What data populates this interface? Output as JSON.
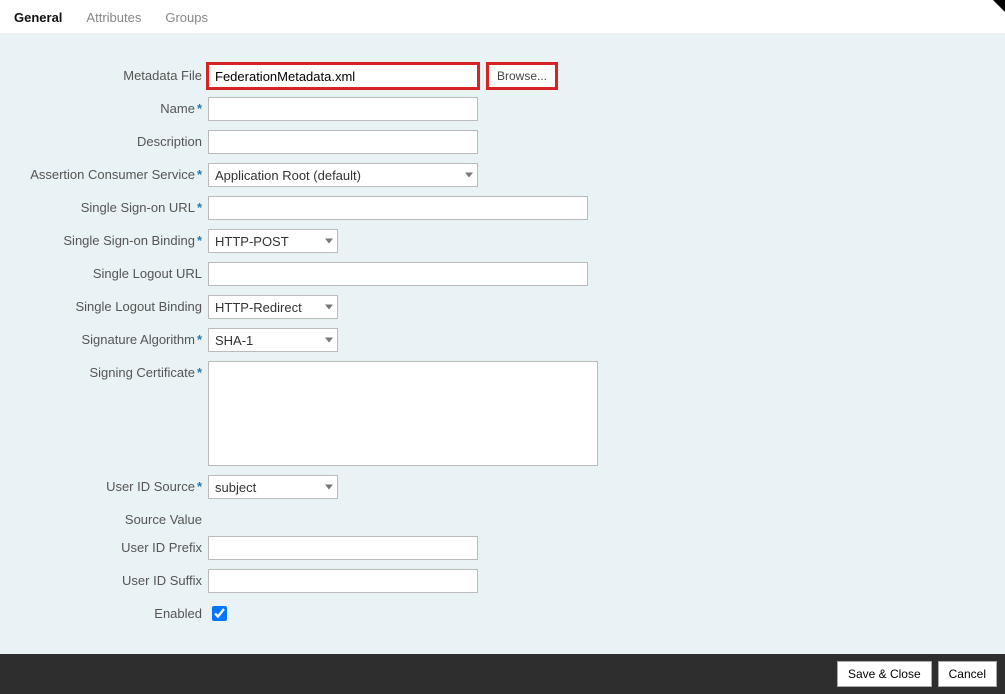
{
  "tabs": {
    "general": "General",
    "attributes": "Attributes",
    "groups": "Groups"
  },
  "labels": {
    "metadata_file": "Metadata File",
    "name": "Name",
    "description": "Description",
    "acs": "Assertion Consumer Service",
    "sso_url": "Single Sign-on URL",
    "sso_binding": "Single Sign-on Binding",
    "slo_url": "Single Logout URL",
    "slo_binding": "Single Logout Binding",
    "sig_alg": "Signature Algorithm",
    "signing_cert": "Signing Certificate",
    "uid_source": "User ID Source",
    "source_value": "Source Value",
    "uid_prefix": "User ID Prefix",
    "uid_suffix": "User ID Suffix",
    "enabled": "Enabled"
  },
  "values": {
    "metadata_file": "FederationMetadata.xml",
    "name": "",
    "description": "",
    "acs": "Application Root (default)",
    "sso_url": "",
    "sso_binding": "HTTP-POST",
    "slo_url": "",
    "slo_binding": "HTTP-Redirect",
    "sig_alg": "SHA-1",
    "signing_cert": "",
    "uid_source": "subject",
    "uid_prefix": "",
    "uid_suffix": "",
    "enabled": true
  },
  "buttons": {
    "browse": "Browse...",
    "save_close": "Save & Close",
    "cancel": "Cancel"
  }
}
